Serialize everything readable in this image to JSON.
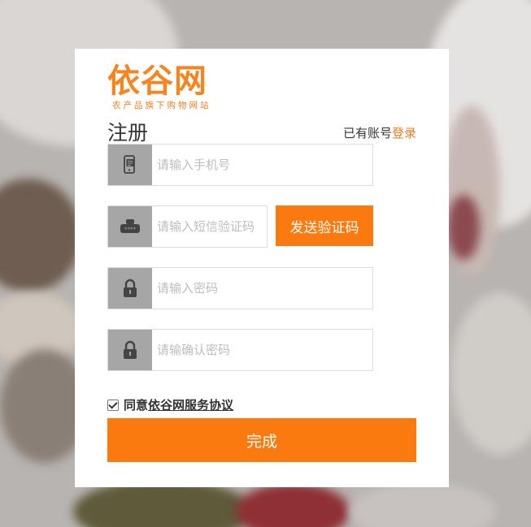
{
  "brand": {
    "logo_text": "依谷网",
    "tagline": "农产品旗下购物网站"
  },
  "form": {
    "title": "注册",
    "login_prompt": "已有账号",
    "login_link": "登录",
    "phone_placeholder": "请输入手机号",
    "sms_placeholder": "请输入短信验证码",
    "send_code_label": "发送验证码",
    "password_placeholder": "请输入密码",
    "confirm_placeholder": "请输确认密码",
    "agree_prefix": "同意",
    "agreement_link": "依谷网服务协议",
    "agree_checked": true,
    "submit_label": "完成"
  },
  "colors": {
    "accent": "#fb7a10",
    "icon_box": "#a6a6a6"
  },
  "icons": {
    "phone": "phone-icon",
    "sms": "keyboard-code-icon",
    "password": "lock-icon",
    "confirm": "lock-icon"
  }
}
